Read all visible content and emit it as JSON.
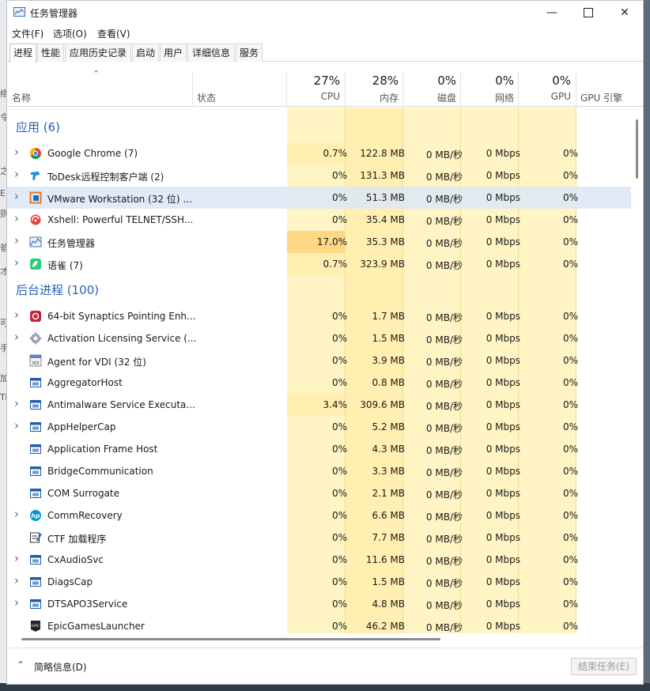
{
  "window": {
    "title": "任务管理器"
  },
  "menu": [
    "文件(F)",
    "选项(O)",
    "查看(V)"
  ],
  "tabs": [
    "进程",
    "性能",
    "应用历史记录",
    "启动",
    "用户",
    "详细信息",
    "服务"
  ],
  "columns": {
    "name": "名称",
    "status": "状态",
    "cpu": {
      "pct": "27%",
      "label": "CPU"
    },
    "memory": {
      "pct": "28%",
      "label": "内存"
    },
    "disk": {
      "pct": "0%",
      "label": "磁盘"
    },
    "network": {
      "pct": "0%",
      "label": "网络"
    },
    "gpu": {
      "pct": "0%",
      "label": "GPU"
    },
    "gpu_engine": "GPU 引擎"
  },
  "groups": [
    {
      "title": "应用 (6)",
      "rows": [
        {
          "name": "Google Chrome (7)",
          "icon": "chrome-icon",
          "expand": true,
          "cpu": "0.7%",
          "mem": "122.8 MB",
          "disk": "0 MB/秒",
          "net": "0 Mbps",
          "gpu": "0%"
        },
        {
          "name": "ToDesk远程控制客户端 (2)",
          "icon": "todesk-icon",
          "expand": true,
          "cpu": "0%",
          "mem": "131.3 MB",
          "disk": "0 MB/秒",
          "net": "0 Mbps",
          "gpu": "0%"
        },
        {
          "name": "VMware Workstation (32 位) ...",
          "icon": "vmware-icon",
          "expand": true,
          "cpu": "0%",
          "mem": "51.3 MB",
          "disk": "0 MB/秒",
          "net": "0 Mbps",
          "gpu": "0%",
          "highlight": true
        },
        {
          "name": "Xshell: Powerful TELNET/SSH...",
          "icon": "xshell-icon",
          "expand": true,
          "cpu": "0%",
          "mem": "35.4 MB",
          "disk": "0 MB/秒",
          "net": "0 Mbps",
          "gpu": "0%"
        },
        {
          "name": "任务管理器",
          "icon": "task-manager-icon",
          "expand": true,
          "cpu": "17.0%",
          "mem": "35.3 MB",
          "disk": "0 MB/秒",
          "net": "0 Mbps",
          "gpu": "0%"
        },
        {
          "name": "语雀 (7)",
          "icon": "yuque-icon",
          "expand": true,
          "cpu": "0.7%",
          "mem": "323.9 MB",
          "disk": "0 MB/秒",
          "net": "0 Mbps",
          "gpu": "0%"
        }
      ]
    },
    {
      "title": "后台进程 (100)",
      "rows": [
        {
          "name": "64-bit Synaptics Pointing Enh...",
          "icon": "synaptics-icon",
          "expand": true,
          "cpu": "0%",
          "mem": "1.7 MB",
          "disk": "0 MB/秒",
          "net": "0 Mbps",
          "gpu": "0%"
        },
        {
          "name": "Activation Licensing Service (...",
          "icon": "gear-icon",
          "expand": true,
          "cpu": "0%",
          "mem": "1.5 MB",
          "disk": "0 MB/秒",
          "net": "0 Mbps",
          "gpu": "0%"
        },
        {
          "name": "Agent for VDI (32 位)",
          "icon": "vdi-icon",
          "expand": false,
          "cpu": "0%",
          "mem": "3.9 MB",
          "disk": "0 MB/秒",
          "net": "0 Mbps",
          "gpu": "0%"
        },
        {
          "name": "AggregatorHost",
          "icon": "window-icon",
          "expand": false,
          "cpu": "0%",
          "mem": "0.8 MB",
          "disk": "0 MB/秒",
          "net": "0 Mbps",
          "gpu": "0%"
        },
        {
          "name": "Antimalware Service Executa...",
          "icon": "window-icon",
          "expand": true,
          "cpu": "3.4%",
          "mem": "309.6 MB",
          "disk": "0 MB/秒",
          "net": "0 Mbps",
          "gpu": "0%"
        },
        {
          "name": "AppHelperCap",
          "icon": "window-icon",
          "expand": true,
          "cpu": "0%",
          "mem": "5.2 MB",
          "disk": "0 MB/秒",
          "net": "0 Mbps",
          "gpu": "0%"
        },
        {
          "name": "Application Frame Host",
          "icon": "window-icon",
          "expand": false,
          "cpu": "0%",
          "mem": "4.3 MB",
          "disk": "0 MB/秒",
          "net": "0 Mbps",
          "gpu": "0%"
        },
        {
          "name": "BridgeCommunication",
          "icon": "window-icon",
          "expand": false,
          "cpu": "0%",
          "mem": "3.3 MB",
          "disk": "0 MB/秒",
          "net": "0 Mbps",
          "gpu": "0%"
        },
        {
          "name": "COM Surrogate",
          "icon": "window-icon",
          "expand": false,
          "cpu": "0%",
          "mem": "2.1 MB",
          "disk": "0 MB/秒",
          "net": "0 Mbps",
          "gpu": "0%"
        },
        {
          "name": "CommRecovery",
          "icon": "hp-icon",
          "expand": true,
          "cpu": "0%",
          "mem": "6.6 MB",
          "disk": "0 MB/秒",
          "net": "0 Mbps",
          "gpu": "0%"
        },
        {
          "name": "CTF 加载程序",
          "icon": "ctf-icon",
          "expand": false,
          "cpu": "0%",
          "mem": "7.7 MB",
          "disk": "0 MB/秒",
          "net": "0 Mbps",
          "gpu": "0%"
        },
        {
          "name": "CxAudioSvc",
          "icon": "window-icon",
          "expand": true,
          "cpu": "0%",
          "mem": "11.6 MB",
          "disk": "0 MB/秒",
          "net": "0 Mbps",
          "gpu": "0%"
        },
        {
          "name": "DiagsCap",
          "icon": "window-icon",
          "expand": true,
          "cpu": "0%",
          "mem": "1.5 MB",
          "disk": "0 MB/秒",
          "net": "0 Mbps",
          "gpu": "0%"
        },
        {
          "name": "DTSAPO3Service",
          "icon": "window-icon",
          "expand": true,
          "cpu": "0%",
          "mem": "4.8 MB",
          "disk": "0 MB/秒",
          "net": "0 Mbps",
          "gpu": "0%"
        },
        {
          "name": "EpicGamesLauncher",
          "icon": "epic-icon",
          "expand": false,
          "cpu": "0%",
          "mem": "46.2 MB",
          "disk": "0 MB/秒",
          "net": "0 Mbps",
          "gpu": "0%"
        }
      ]
    }
  ],
  "footer": {
    "fewer_details": "简略信息(D)",
    "end_task": "结束任务(E)"
  },
  "colors": {
    "heat_light": "#fff4c4",
    "heat_mid": "#ffefb0",
    "heat_strong": "#ffd886",
    "group_title": "#2b63b4",
    "row_highlight": "#e6f0fa"
  },
  "background_fragments": [
    "络",
    "令",
    "之",
    "E",
    "则",
    "爸",
    "才",
    "可",
    "手",
    "加",
    "Ti"
  ]
}
